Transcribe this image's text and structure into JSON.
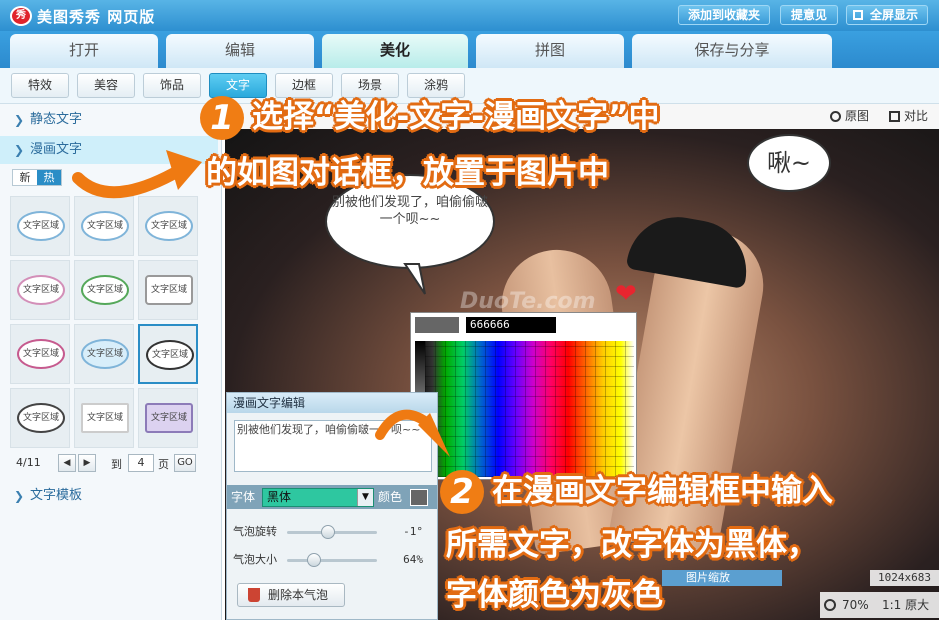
{
  "app": {
    "logo": "秀",
    "title": "美图秀秀 网页版"
  },
  "top_buttons": {
    "favorite": "添加到收藏夹",
    "feedback": "提意见",
    "fullscreen": "全屏显示"
  },
  "main_tabs": [
    "打开",
    "编辑",
    "美化",
    "拼图",
    "保存与分享"
  ],
  "sub_tabs": [
    "特效",
    "美容",
    "饰品",
    "文字",
    "边框",
    "场景",
    "涂鸦"
  ],
  "sidebar": {
    "static_text": "静态文字",
    "comic_text": "漫画文字",
    "text_template": "文字模板",
    "filter_new": "新",
    "filter_hot": "热",
    "tile_label": "文字区域",
    "pager": {
      "page": "4/11",
      "goto_label": "到",
      "page_input": "4",
      "page_unit": "页",
      "go": "GO"
    }
  },
  "view_bar": {
    "original": "原图",
    "compare": "对比"
  },
  "canvas": {
    "bubble_text": "别被他们发现了，咱偷偷啵一个呗~~",
    "kiss_text": "啾~",
    "watermark": "DuoTe.com"
  },
  "color_picker": {
    "hex": "666666",
    "selected_color": "#666666"
  },
  "edit_panel": {
    "title": "漫画文字编辑",
    "text_value": "别被他们发现了，咱偷偷啵一个呗~~",
    "font_label": "字体",
    "font_value": "黑体",
    "color_label": "颜色",
    "color_value": "#666666",
    "rotate_label": "气泡旋转",
    "rotate_value": "-1°",
    "rotate_level": 0.45,
    "size_label": "气泡大小",
    "size_value": "64%",
    "size_level": 0.3,
    "delete_button": "删除本气泡"
  },
  "zoom": {
    "label": "图片缩放",
    "image_size": "1024x683",
    "zoom_value": "70%",
    "actual_size": "1:1 原大"
  },
  "annotations": {
    "step1_number": "1",
    "step1_line1": "选择“美化-文字-漫画文字”中",
    "step1_line2": "的如图对话框，放置于图片中",
    "step2_number": "2",
    "step2_line1": "在漫画文字编辑框中输入",
    "step2_line2": "所需文字，改字体为黑体，",
    "step2_line3": "字体颜色为灰色"
  },
  "colors": {
    "accent_blue": "#2d8fd0",
    "annotation_orange": "#e26b12",
    "active_subtab": "#2aa9dc"
  }
}
